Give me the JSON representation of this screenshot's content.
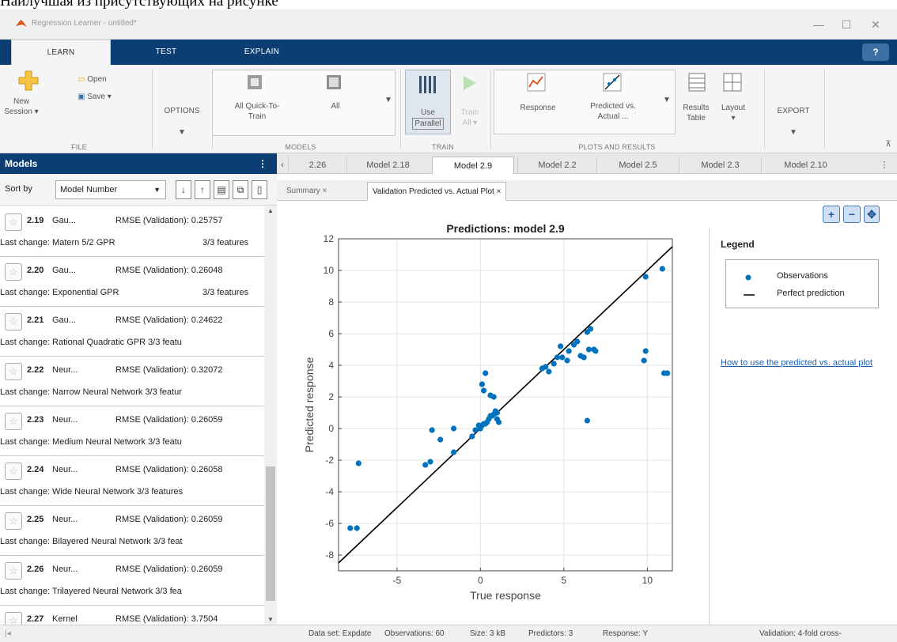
{
  "caption": "Наилучшая из присутствующих на рисунке",
  "window": {
    "title": "Regression Learner - untitled*"
  },
  "ribbon_tabs": [
    "LEARN",
    "TEST",
    "EXPLAIN"
  ],
  "ribbon": {
    "new_session": [
      "New",
      "Session ▾"
    ],
    "open": "Open",
    "save": "Save ▾",
    "options": "OPTIONS",
    "file_group": "FILE",
    "all_quick": [
      "All Quick-To-",
      "Train"
    ],
    "all": "All",
    "models_group": "MODELS",
    "use_parallel": [
      "Use",
      "Parallel"
    ],
    "train_all": [
      "Train",
      "All ▾"
    ],
    "train_group": "TRAIN",
    "response": "Response",
    "predicted_actual": [
      "Predicted vs.",
      "Actual ..."
    ],
    "plots_group": "PLOTS AND RESULTS",
    "results_table": [
      "Results",
      "Table"
    ],
    "layout": [
      "Layout",
      "▾"
    ],
    "export": "EXPORT"
  },
  "models_panel": {
    "title": "Models",
    "sort_label": "Sort by",
    "sort_value": "Model Number",
    "items": [
      {
        "num": "2.19",
        "type": "Gau...",
        "rmse": "RMSE (Validation): 0.25757",
        "change": "Last change: Matern 5/2 GPR",
        "features": "3/3 features"
      },
      {
        "num": "2.20",
        "type": "Gau...",
        "rmse": "RMSE (Validation): 0.26048",
        "change": "Last change: Exponential GPR",
        "features": "3/3 features"
      },
      {
        "num": "2.21",
        "type": "Gau...",
        "rmse": "RMSE (Validation): 0.24622",
        "change": "Last change: Rational Quadratic GPR  3/3 featu",
        "features": ""
      },
      {
        "num": "2.22",
        "type": "Neur...",
        "rmse": "RMSE (Validation): 0.32072",
        "change": "Last change: Narrow Neural Network  3/3 featur",
        "features": ""
      },
      {
        "num": "2.23",
        "type": "Neur...",
        "rmse": "RMSE (Validation): 0.26059",
        "change": "Last change: Medium Neural Network  3/3 featu",
        "features": ""
      },
      {
        "num": "2.24",
        "type": "Neur...",
        "rmse": "RMSE (Validation): 0.26058",
        "change": "Last change: Wide Neural Network  3/3 features",
        "features": ""
      },
      {
        "num": "2.25",
        "type": "Neur...",
        "rmse": "RMSE (Validation): 0.26059",
        "change": "Last change: Bilayered Neural Network  3/3 feat",
        "features": ""
      },
      {
        "num": "2.26",
        "type": "Neur...",
        "rmse": "RMSE (Validation): 0.26059",
        "change": "Last change: Trilayered Neural Network  3/3 fea",
        "features": ""
      },
      {
        "num": "2.27",
        "type": "Kernel",
        "rmse": "RMSE (Validation): 3.7504",
        "change": "",
        "features": ""
      }
    ]
  },
  "model_tabs": [
    "2.26",
    "Model 2.18",
    "Model 2.9",
    "Model 2.2",
    "Model 2.5",
    "Model 2.3",
    "Model 2.10"
  ],
  "doc_tabs": [
    "Summary ×",
    "Validation Predicted vs. Actual Plot ×"
  ],
  "legend": {
    "title": "Legend",
    "observations": "Observations",
    "perfect": "Perfect prediction",
    "link": "How to use the predicted vs. actual plot"
  },
  "status": {
    "dataset": "Data set: Expdate",
    "observations": "Observations: 60",
    "size": "Size: 3 kB",
    "predictors": "Predictors: 3",
    "response": "Response: Y",
    "validation": "Validation: 4-fold cross-"
  },
  "chart_data": {
    "type": "scatter",
    "title": "Predictions: model 2.9",
    "xlabel": "True response",
    "ylabel": "Predicted response",
    "xlim": [
      -8.5,
      11.5
    ],
    "ylim": [
      -9,
      12
    ],
    "xticks": [
      -5,
      0,
      5,
      10
    ],
    "yticks": [
      -8,
      -6,
      -4,
      -2,
      0,
      2,
      4,
      6,
      8,
      10,
      12
    ],
    "grid": true,
    "series": [
      {
        "name": "Observations",
        "color": "#0072bd",
        "x": [
          -7.8,
          -7.4,
          -7.3,
          -3.3,
          -3.0,
          -2.9,
          -2.4,
          -1.6,
          -1.6,
          -0.5,
          -0.3,
          -0.1,
          0.0,
          0.1,
          0.2,
          0.3,
          0.4,
          0.5,
          0.6,
          0.7,
          0.8,
          0.9,
          1.0,
          1.1,
          0.1,
          0.2,
          0.3,
          0.6,
          0.8,
          1.0,
          3.7,
          3.9,
          4.1,
          4.4,
          4.6,
          4.8,
          4.9,
          5.2,
          5.3,
          5.6,
          5.8,
          6.0,
          6.2,
          6.4,
          6.5,
          6.6,
          6.8,
          6.9,
          6.4,
          9.8,
          9.9,
          9.9,
          10.9,
          11.0,
          11.2
        ],
        "y": [
          -6.3,
          -6.3,
          -2.2,
          -2.3,
          -2.1,
          -0.1,
          -0.7,
          -1.5,
          0.0,
          -0.5,
          -0.1,
          0.2,
          0.0,
          0.2,
          0.3,
          0.3,
          0.4,
          0.6,
          0.8,
          0.8,
          0.9,
          1.1,
          1.0,
          0.4,
          2.8,
          2.4,
          3.5,
          2.1,
          2.0,
          0.6,
          3.8,
          3.9,
          3.6,
          4.1,
          4.5,
          5.2,
          4.5,
          4.3,
          4.9,
          5.3,
          5.5,
          4.6,
          4.5,
          6.1,
          5.0,
          6.3,
          5.0,
          4.9,
          0.5,
          4.3,
          9.6,
          4.9,
          10.1,
          3.5,
          3.5
        ]
      },
      {
        "name": "Perfect prediction",
        "color": "#000000",
        "x": [
          -8.5,
          11.5
        ],
        "y": [
          -8.5,
          11.5
        ]
      }
    ]
  }
}
